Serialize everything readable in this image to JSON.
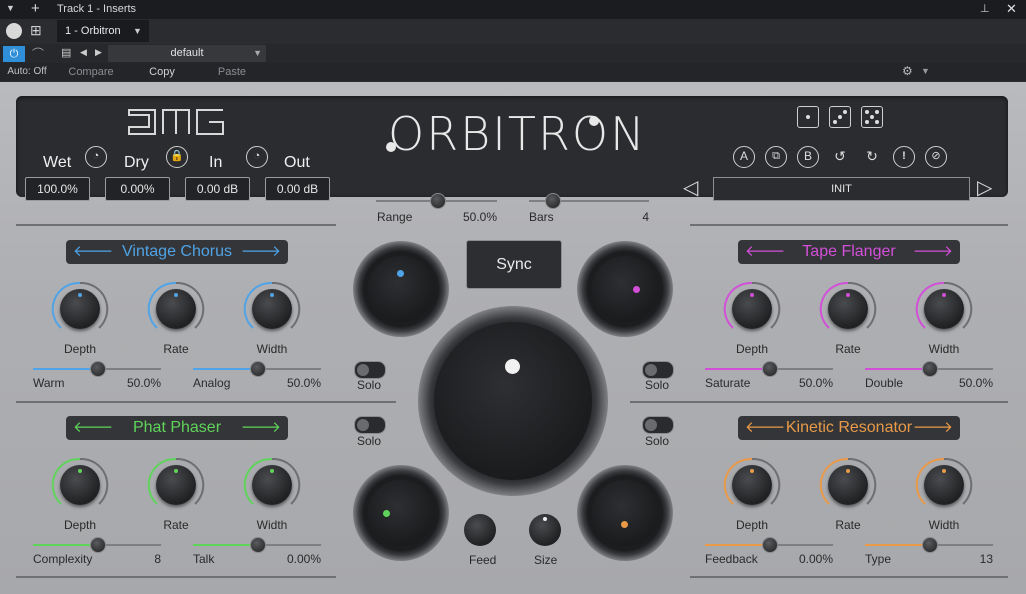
{
  "host": {
    "title": "Track 1 - Inserts",
    "tab": "1 - Orbitron",
    "preset": "default",
    "auto": "Auto: Off",
    "compare": "Compare",
    "copy": "Copy",
    "paste": "Paste"
  },
  "plugin": {
    "logo": "ORBITRON",
    "brand": "JMG",
    "wet_label": "Wet",
    "wet_value": "100.0%",
    "dry_label": "Dry",
    "dry_value": "0.00%",
    "in_label": "In",
    "in_value": "0.00 dB",
    "out_label": "Out",
    "out_value": "0.00 dB",
    "preset_name": "INIT",
    "ab_a": "A",
    "ab_b": "B",
    "range_label": "Range",
    "range_value": "50.0%",
    "bars_label": "Bars",
    "bars_value": "4",
    "sync_label": "Sync",
    "feed_label": "Feed",
    "size_label": "Size",
    "solo_label": "Solo"
  },
  "modules": {
    "tl": {
      "name": "Vintage Chorus",
      "color": "#4fa3e6",
      "k1": "Depth",
      "k2": "Rate",
      "k3": "Width",
      "s1": "Warm",
      "s1v": "50.0%",
      "s2": "Analog",
      "s2v": "50.0%",
      "s1level": 0.5,
      "s2level": 0.5
    },
    "tr": {
      "name": "Tape Flanger",
      "color": "#d24fd8",
      "k1": "Depth",
      "k2": "Rate",
      "k3": "Width",
      "s1": "Saturate",
      "s1v": "50.0%",
      "s2": "Double",
      "s2v": "50.0%",
      "s1level": 0.5,
      "s2level": 0.5
    },
    "bl": {
      "name": "Phat Phaser",
      "color": "#5fd35a",
      "k1": "Depth",
      "k2": "Rate",
      "k3": "Width",
      "s1": "Complexity",
      "s1v": "8",
      "s2": "Talk",
      "s2v": "0.00%",
      "s1level": 0.5,
      "s2level": 0.5
    },
    "br": {
      "name": "Kinetic Resonator",
      "color": "#e89a48",
      "k1": "Depth",
      "k2": "Rate",
      "k3": "Width",
      "s1": "Feedback",
      "s1v": "0.00%",
      "s2": "Type",
      "s2v": "13",
      "s1level": 0.5,
      "s2level": 0.5
    }
  },
  "icons": {
    "menu": "menu-arrow-icon",
    "add": "plus-icon",
    "pin": "pin-icon",
    "close": "close-icon",
    "power": "power-icon",
    "gear": "gear-icon",
    "dice": "dice-icon"
  }
}
